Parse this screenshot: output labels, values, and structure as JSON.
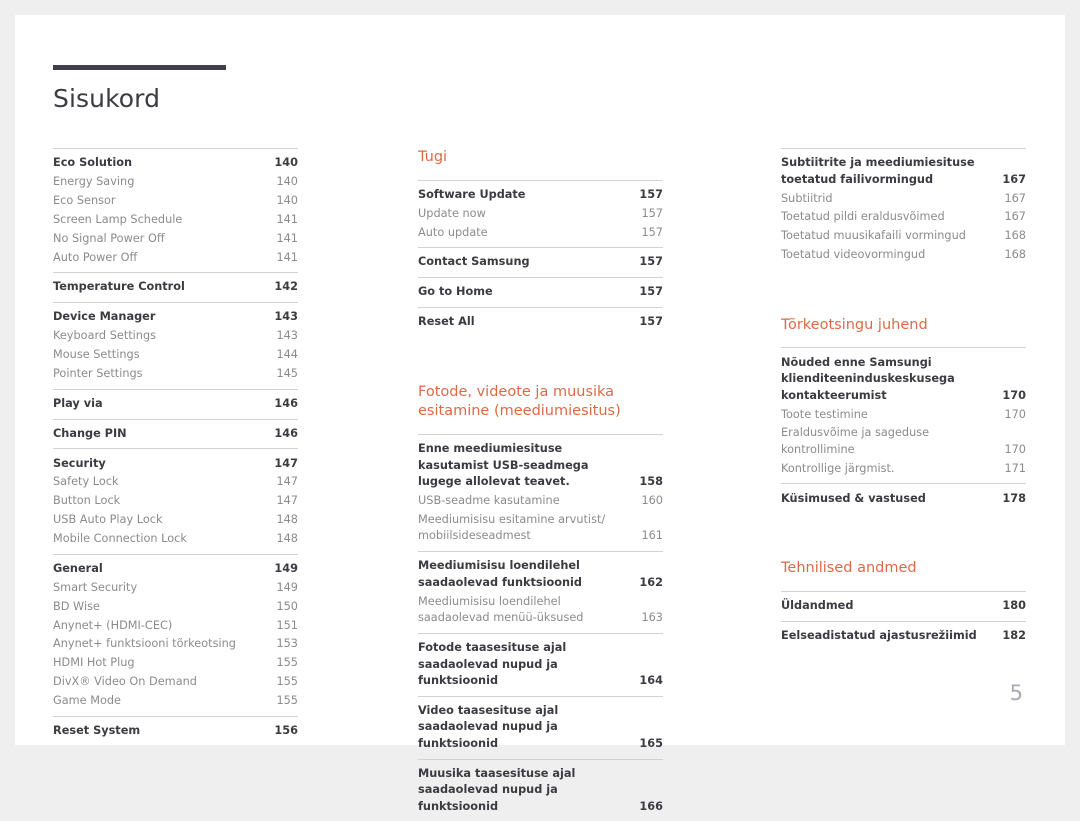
{
  "document": {
    "title": "Sisukord",
    "page_number": "5",
    "accent_color": "#dd6a46",
    "title_bar_color": "#403d4d"
  },
  "columns": [
    {
      "name": "left",
      "heading": null,
      "groups": [
        {
          "entries": [
            {
              "label": "Eco Solution",
              "page": "140",
              "level": 1
            },
            {
              "label": "Energy Saving",
              "page": "140",
              "level": 2
            },
            {
              "label": "Eco Sensor",
              "page": "140",
              "level": 2
            },
            {
              "label": "Screen Lamp Schedule",
              "page": "141",
              "level": 2
            },
            {
              "label": "No Signal Power Off",
              "page": "141",
              "level": 2
            },
            {
              "label": "Auto Power Off",
              "page": "141",
              "level": 2
            }
          ]
        },
        {
          "entries": [
            {
              "label": "Temperature Control",
              "page": "142",
              "level": 1
            }
          ]
        },
        {
          "entries": [
            {
              "label": "Device Manager",
              "page": "143",
              "level": 1
            },
            {
              "label": "Keyboard Settings",
              "page": "143",
              "level": 2
            },
            {
              "label": "Mouse Settings",
              "page": "144",
              "level": 2
            },
            {
              "label": "Pointer Settings",
              "page": "145",
              "level": 2
            }
          ]
        },
        {
          "entries": [
            {
              "label": "Play via",
              "page": "146",
              "level": 1
            }
          ]
        },
        {
          "entries": [
            {
              "label": "Change PIN",
              "page": "146",
              "level": 1
            }
          ]
        },
        {
          "entries": [
            {
              "label": "Security",
              "page": "147",
              "level": 1
            },
            {
              "label": "Safety Lock",
              "page": "147",
              "level": 2
            },
            {
              "label": "Button Lock",
              "page": "147",
              "level": 2
            },
            {
              "label": "USB Auto Play Lock",
              "page": "148",
              "level": 2
            },
            {
              "label": "Mobile Connection Lock",
              "page": "148",
              "level": 2
            }
          ]
        },
        {
          "entries": [
            {
              "label": "General",
              "page": "149",
              "level": 1
            },
            {
              "label": "Smart Security",
              "page": "149",
              "level": 2
            },
            {
              "label": "BD Wise",
              "page": "150",
              "level": 2
            },
            {
              "label": "Anynet+ (HDMI-CEC)",
              "page": "151",
              "level": 2
            },
            {
              "label": "Anynet+ funktsiooni tõrkeotsing",
              "page": "153",
              "level": 2
            },
            {
              "label": "HDMI Hot Plug",
              "page": "155",
              "level": 2
            },
            {
              "label": "DivX® Video On Demand",
              "page": "155",
              "level": 2
            },
            {
              "label": "Game Mode",
              "page": "155",
              "level": 2
            }
          ]
        },
        {
          "entries": [
            {
              "label": "Reset System",
              "page": "156",
              "level": 1
            }
          ]
        }
      ]
    },
    {
      "name": "middle",
      "sections": [
        {
          "heading": "Tugi",
          "groups": [
            {
              "entries": [
                {
                  "label": "Software Update",
                  "page": "157",
                  "level": 1
                },
                {
                  "label": "Update now",
                  "page": "157",
                  "level": 2
                },
                {
                  "label": "Auto update",
                  "page": "157",
                  "level": 2
                }
              ]
            },
            {
              "entries": [
                {
                  "label": "Contact Samsung",
                  "page": "157",
                  "level": 1
                }
              ]
            },
            {
              "entries": [
                {
                  "label": "Go to Home",
                  "page": "157",
                  "level": 1
                }
              ]
            },
            {
              "entries": [
                {
                  "label": "Reset All",
                  "page": "157",
                  "level": 1
                }
              ]
            }
          ]
        },
        {
          "heading": "Fotode, videote ja muusika esitamine (meediumiesitus)",
          "groups": [
            {
              "entries": [
                {
                  "label": "Enne meediumiesituse kasutamist USB-seadmega lugege allolevat teavet.",
                  "page": "158",
                  "level": 1
                },
                {
                  "label": "USB-seadme kasutamine",
                  "page": "160",
                  "level": 2
                },
                {
                  "label": "Meediumisisu esitamine arvutist/ mobiilsideseadmest",
                  "page": "161",
                  "level": 2
                }
              ]
            },
            {
              "entries": [
                {
                  "label": "Meediumisisu loendilehel saadaolevad funktsioonid",
                  "page": "162",
                  "level": 1
                },
                {
                  "label": "Meediumisisu loendilehel saadaolevad menüü-üksused",
                  "page": "163",
                  "level": 2
                }
              ]
            },
            {
              "entries": [
                {
                  "label": "Fotode taasesituse ajal saadaolevad nupud ja funktsioonid",
                  "page": "164",
                  "level": 1
                }
              ]
            },
            {
              "entries": [
                {
                  "label": "Video taasesituse ajal saadaolevad nupud ja funktsioonid",
                  "page": "165",
                  "level": 1
                }
              ]
            },
            {
              "entries": [
                {
                  "label": "Muusika taasesituse ajal saadaolevad nupud ja funktsioonid",
                  "page": "166",
                  "level": 1
                }
              ]
            }
          ]
        }
      ]
    },
    {
      "name": "right",
      "sections": [
        {
          "heading": null,
          "groups": [
            {
              "entries": [
                {
                  "label": "Subtiitrite ja meediumiesituse toetatud failivormingud",
                  "page": "167",
                  "level": 1
                },
                {
                  "label": "Subtiitrid",
                  "page": "167",
                  "level": 2
                },
                {
                  "label": "Toetatud pildi eraldusvõimed",
                  "page": "167",
                  "level": 2
                },
                {
                  "label": "Toetatud muusikafaili vormingud",
                  "page": "168",
                  "level": 2
                },
                {
                  "label": "Toetatud videovormingud",
                  "page": "168",
                  "level": 2
                }
              ]
            }
          ]
        },
        {
          "heading": "Tõrkeotsingu juhend",
          "groups": [
            {
              "entries": [
                {
                  "label": "Nõuded enne Samsungi klienditeeninduskeskusega kontakteerumist",
                  "page": "170",
                  "level": 1
                },
                {
                  "label": "Toote testimine",
                  "page": "170",
                  "level": 2
                },
                {
                  "label": "Eraldusvõime ja sageduse kontrollimine",
                  "page": "170",
                  "level": 2
                },
                {
                  "label": "Kontrollige järgmist.",
                  "page": "171",
                  "level": 2
                }
              ]
            },
            {
              "entries": [
                {
                  "label": "Küsimused & vastused",
                  "page": "178",
                  "level": 1
                }
              ]
            }
          ]
        },
        {
          "heading": "Tehnilised andmed",
          "groups": [
            {
              "entries": [
                {
                  "label": "Üldandmed",
                  "page": "180",
                  "level": 1
                }
              ]
            },
            {
              "entries": [
                {
                  "label": "Eelseadistatud ajastusrežiimid",
                  "page": "182",
                  "level": 1
                }
              ]
            }
          ]
        }
      ]
    }
  ]
}
